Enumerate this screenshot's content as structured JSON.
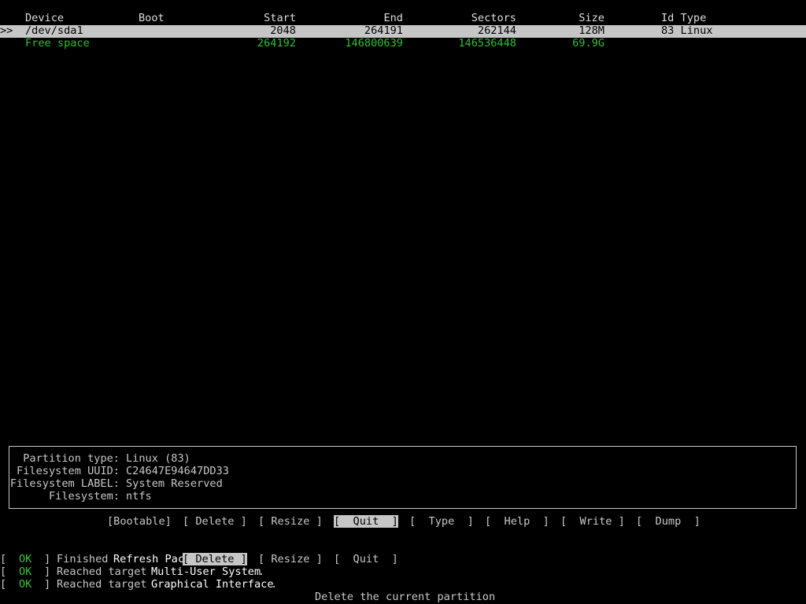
{
  "table": {
    "headers": {
      "device": "Device",
      "boot": "Boot",
      "start": "Start",
      "end": "End",
      "sectors": "Sectors",
      "size": "Size",
      "id_type": "Id Type"
    },
    "selector": ">>",
    "rows": [
      {
        "device": "/dev/sda1",
        "start": "2048",
        "end": "264191",
        "sectors": "262144",
        "size": "128M",
        "id_type": "83 Linux"
      },
      {
        "device": "Free space",
        "start": "264192",
        "end": "146800639",
        "sectors": "146536448",
        "size": "69.9G"
      }
    ]
  },
  "info": {
    "partition_type_label": "Partition type:",
    "partition_type_value": "Linux (83)",
    "fs_uuid_label": "Filesystem UUID:",
    "fs_uuid_value": "C24647E94647DD33",
    "fs_label_label": "Filesystem LABEL:",
    "fs_label_value": "System Reserved",
    "fs_label2": "Filesystem:",
    "fs_value": "ntfs"
  },
  "menu": [
    "[Bootable]",
    "[ Delete ]",
    "[ Resize ]",
    "[  Quit  ]",
    "[  Type  ]",
    "[  Help  ]",
    "[  Write ]",
    "[  Dump  ]"
  ],
  "menu_active_index": 3,
  "boot_log": [
    {
      "status": "OK",
      "prefix": "Finished",
      "text": "Refresh Pac"
    },
    {
      "status": "OK",
      "prefix": "Reached target",
      "text": "Multi-User System",
      "suffix": "."
    },
    {
      "status": "OK",
      "prefix": "Reached target",
      "text": "Graphical Interface",
      "suffix": "."
    }
  ],
  "overlay_menu": [
    "[ Delete ]",
    "[ Resize ]",
    "[  Quit  ]"
  ],
  "status_hint": "Delete the current partition",
  "colors": {
    "background": "#000000",
    "selection": "#c6c6c6",
    "free_space": "#2fbf2f",
    "ok": "#34c534"
  }
}
